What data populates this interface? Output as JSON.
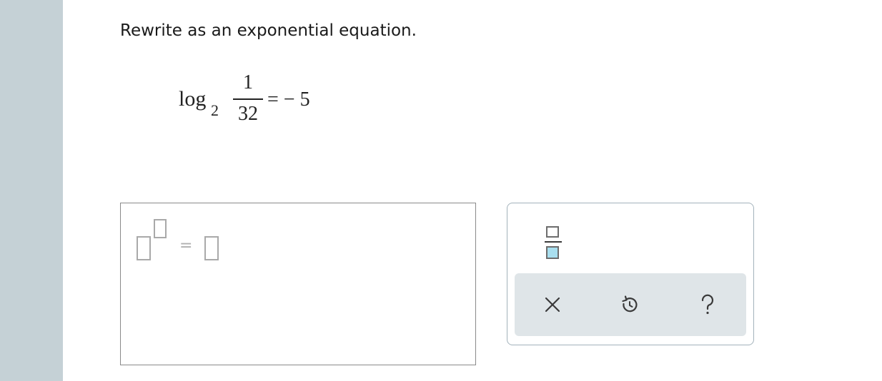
{
  "question": {
    "prompt": "Rewrite as an exponential equation."
  },
  "equation": {
    "log_text": "log",
    "base": "2",
    "numerator": "1",
    "denominator": "32",
    "rhs": "= − 5"
  },
  "answer": {
    "equals": "="
  },
  "palette": {
    "tools": [
      "fraction"
    ],
    "actions": [
      "clear",
      "undo",
      "help"
    ],
    "fraction_fill_color": "#a9dfef",
    "action_bar_color": "#dfe5e8"
  },
  "colors": {
    "left_rail": "#c5d1d6",
    "text": "#1a1a1a",
    "icon": "#3a3a3a"
  }
}
